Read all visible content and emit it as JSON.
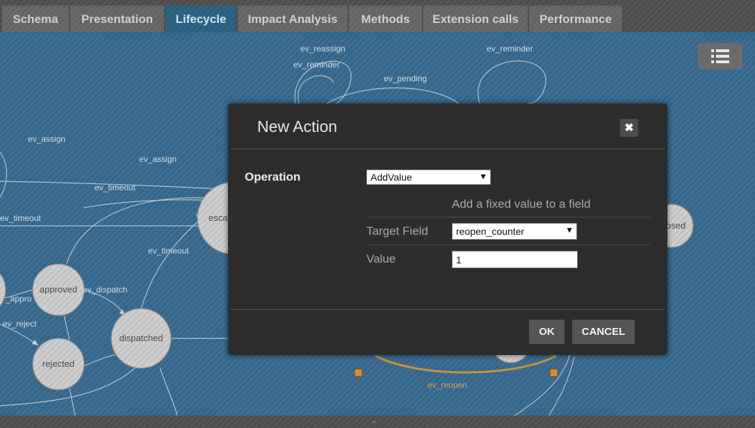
{
  "tabs": [
    {
      "label": "Schema"
    },
    {
      "label": "Presentation"
    },
    {
      "label": "Lifecycle",
      "active": true
    },
    {
      "label": "Impact Analysis"
    },
    {
      "label": "Methods"
    },
    {
      "label": "Extension calls"
    },
    {
      "label": "Performance"
    }
  ],
  "toolbar": {
    "menu_icon": "list-icon"
  },
  "graph": {
    "nodes": {
      "approved": "approved",
      "rejected": "rejected",
      "dispatched": "dispatched",
      "escalated_partial": "esca",
      "closed_partial": "osed"
    },
    "edges": {
      "ev_assign_1": "ev_assign",
      "ev_assign_2": "ev_assign",
      "ev_timeout_1": "ev_timeout",
      "ev_timeout_2": "ev_timeout",
      "ev_timeout_3": "ev_timeout",
      "ev_dispatch": "ev_dispatch",
      "ev_reject": "ev_reject",
      "ev_approve_partial": "_appro",
      "ev_reassign": "ev_reassign",
      "ev_reminder_1": "ev_reminder",
      "ev_reminder_2": "ev_reminder",
      "ev_pending": "ev_pending",
      "ev_reopen": "ev_reopen"
    }
  },
  "modal": {
    "title": "New Action",
    "close_glyph": "✖",
    "operation_label": "Operation",
    "operation_value": "AddValue",
    "description": "Add a fixed value to a field",
    "target_field_label": "Target Field",
    "target_field_value": "reopen_counter",
    "value_label": "Value",
    "value_value": "1",
    "ok_label": "OK",
    "cancel_label": "CANCEL"
  },
  "colors": {
    "canvas_bg": "#3e6f92",
    "active_tab": "#2f6688",
    "modal_bg": "#2d2d2d",
    "reopen_edge": "#d9a24a"
  }
}
